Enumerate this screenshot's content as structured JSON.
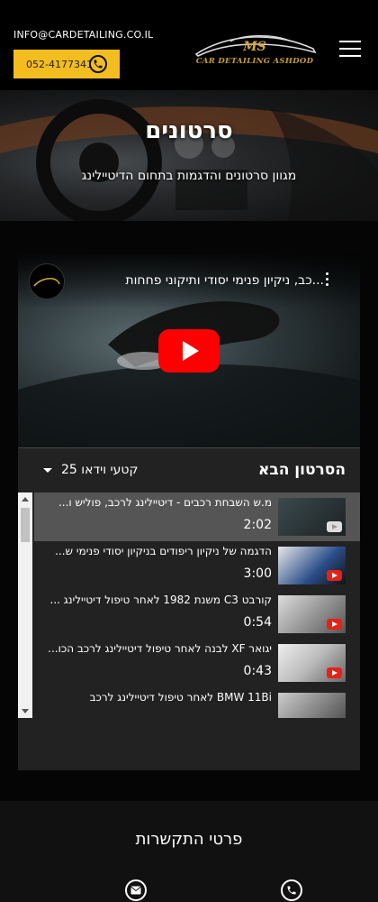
{
  "header": {
    "email": "INFO@CARDETAILING.CO.IL",
    "phone": "052-4177341",
    "logo_initials": "MS",
    "logo_tagline": "CAR DETAILING ASHDOD"
  },
  "hero": {
    "title": "סרטונים",
    "subtitle": "מגוון סרטונים והדגמות בתחום הדיטיילינג"
  },
  "player": {
    "title": "...כב, ניקיון פנימי יסודי ותיקוני פחחות"
  },
  "playlist": {
    "next_label": "הסרטון הבא",
    "count_label": "25 קטעי וידאו",
    "items": [
      {
        "title": "מ.ש השבחת רכבים - דיטיילינג לרכב, פוליש ו...",
        "duration": "2:02"
      },
      {
        "title": "הדגמה של ניקיון ריפודים בניקיון יסודי פנימי ש...",
        "duration": "3:00"
      },
      {
        "title": "קורבט C3 משנת 1982 לאחר טיפול דיטיילינג ...",
        "duration": "0:54"
      },
      {
        "title": "יגואר XF לבנה לאחר טיפול דיטיילינג לרכב הכו...",
        "duration": "0:43"
      },
      {
        "title": "BMW 11Bi לאחר טיפול דיטיילינג לרכב",
        "duration": ""
      }
    ]
  },
  "contact": {
    "title": "פרטי התקשרות"
  },
  "colors": {
    "accent": "#f4bd1f",
    "gold": "#d9a931",
    "youtube_red": "#ff0000"
  }
}
